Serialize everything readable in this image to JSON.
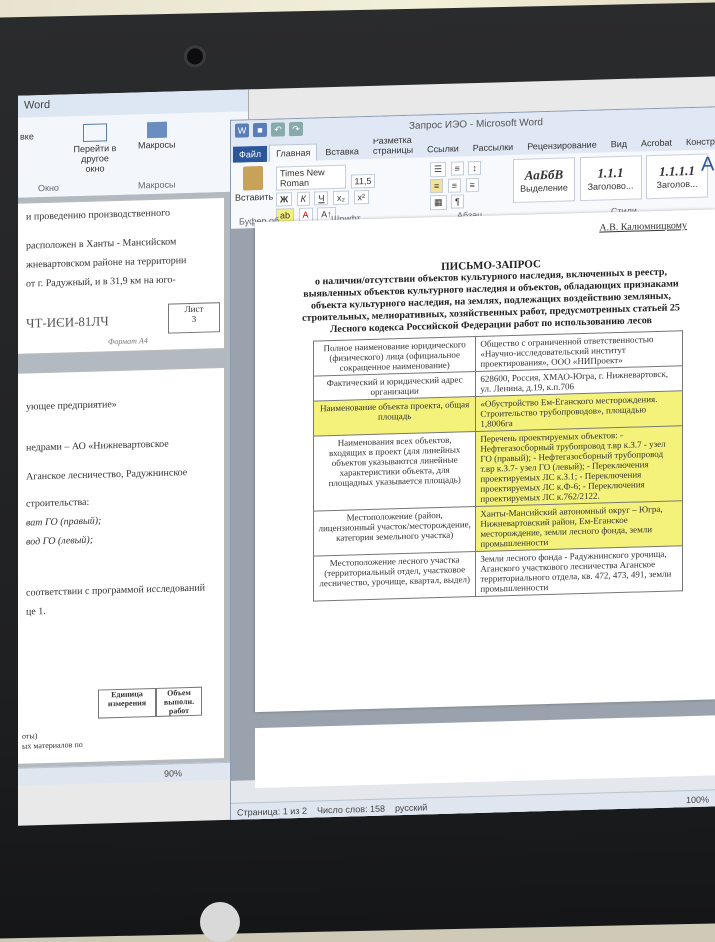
{
  "back_window": {
    "title": "Word",
    "ribbon": {
      "btn_switch_window": "Перейти в другое окно",
      "btn_macros": "Макросы",
      "group_window": "Окно",
      "group_macros": "Макросы",
      "left_fragment": "вке"
    },
    "page1_lines": [
      "и проведению производственного",
      "расположен в Ханты - Мансийском",
      "жневартовском районе на территории",
      "от г. Радужный, и в 31,9 км на юго-"
    ],
    "page1_code": "ИЭИ-ТЧ",
    "page1_code_mirror": "ЧТ-ИЄИ-81ЛЧ",
    "page1_sheet": "Лист",
    "page1_sheet_num": "3",
    "page1_format": "Формат А4",
    "page2_lines": [
      "ующее предприятие»",
      "недрами – АО «Нижневартовское",
      "Аганское лесничество, Радужнинское",
      "строительства:",
      "ват ГО (правый);",
      "вод ГО (левый);",
      "соответствии с программой исследований",
      "це 1."
    ],
    "page2_table_head": [
      "Единица измерения",
      "Объем выполн. работ"
    ],
    "page2_table_row": "оты)",
    "page2_table_row2": "ых материалов по",
    "status": "90%"
  },
  "front_window": {
    "title": "Запрос ИЭО - Microsoft Word",
    "tabs": [
      "Файл",
      "Главная",
      "Вставка",
      "Разметка страницы",
      "Ссылки",
      "Рассылки",
      "Рецензирование",
      "Вид",
      "Acrobat",
      "Конструктор"
    ],
    "font_name": "Times New Roman",
    "font_size": "11,5",
    "paste_label": "Вставить",
    "groups": [
      "Буфер об...",
      "Шрифт",
      "Абзац",
      "Стили"
    ],
    "styles": [
      {
        "sample": "АаБбВ",
        "name": "Выделение"
      },
      {
        "sample": "1.1.1",
        "name": "Заголово..."
      },
      {
        "sample": "1.1.1.1",
        "name": "Заголов..."
      }
    ],
    "change_styles": "Изменить стили",
    "signature": "А.В. Калюмницкому",
    "letter": {
      "title": "ПИСЬМО-ЗАПРОС",
      "body": "о наличии/отсутствии объектов культурного наследия, включенных в реестр, выявленных объектов культурного наследия и объектов, обладающих признаками объекта культурного наследия, на землях, подлежащих воздействию земляных, строительных, мелиоративных, хозяйственных работ, предусмотренных статьей 25 Лесного кодекса Российской Федерации работ по использованию лесов"
    },
    "table": [
      {
        "k": "Полное наименование юридического (физического) лица (официальное сокращенное наименование)",
        "v": "Общество с ограниченной ответственностью «Научно-исследовательский институт проектирования», ООО «НИПроект»"
      },
      {
        "k": "Фактический и юридический адрес организации",
        "v": "628600, Россия, ХМАО-Югра, г. Нижневартовск, ул. Ленина, д.19, к.п.706"
      },
      {
        "k": "Наименование объекта проекта, общая площадь",
        "v": "«Обустройство Ем-Еганского месторождения. Строительство трубопроводов», площадью 1,8006га"
      },
      {
        "k": "Наименования всех объектов, входящих в проект (для линейных объектов указываются линейные характеристики объекта, для площадных указывается площадь)",
        "v": "Перечень проектируемых объектов: - Нефтегазосборный трубопровод т.вр к.З.7 - узел ГО (правый); - Нефтегазосборный трубопровод т.вр к.З.7- узел ГО (левый); - Переключения проектируемых ЛС к.З.1; - Переключения проектируемых ЛС к.Ф-6; - Переключения проектируемых ЛС к.762/2122."
      },
      {
        "k": "Местоположение (район, лицензионный участок/месторождение, категория земельного участка)",
        "v": "Ханты-Мансийский автономный округ – Югра, Нижневартовский район, Ем-Еганское месторождение, земли лесного фонда, земли промышленности"
      },
      {
        "k": "Местоположение лесного участка (территориальный отдел, участковое лесничество, урочище, квартал, выдел)",
        "v": "Земли лесного фонда - Радужнинского урочища, Аганского участкового лесничества Аганское территориального отдела, кв. 472, 473, 491, земли промышленности"
      }
    ],
    "status": {
      "page": "Страница: 1 из 2",
      "words": "Число слов: 158",
      "lang": "русский",
      "zoom": "100%"
    }
  }
}
